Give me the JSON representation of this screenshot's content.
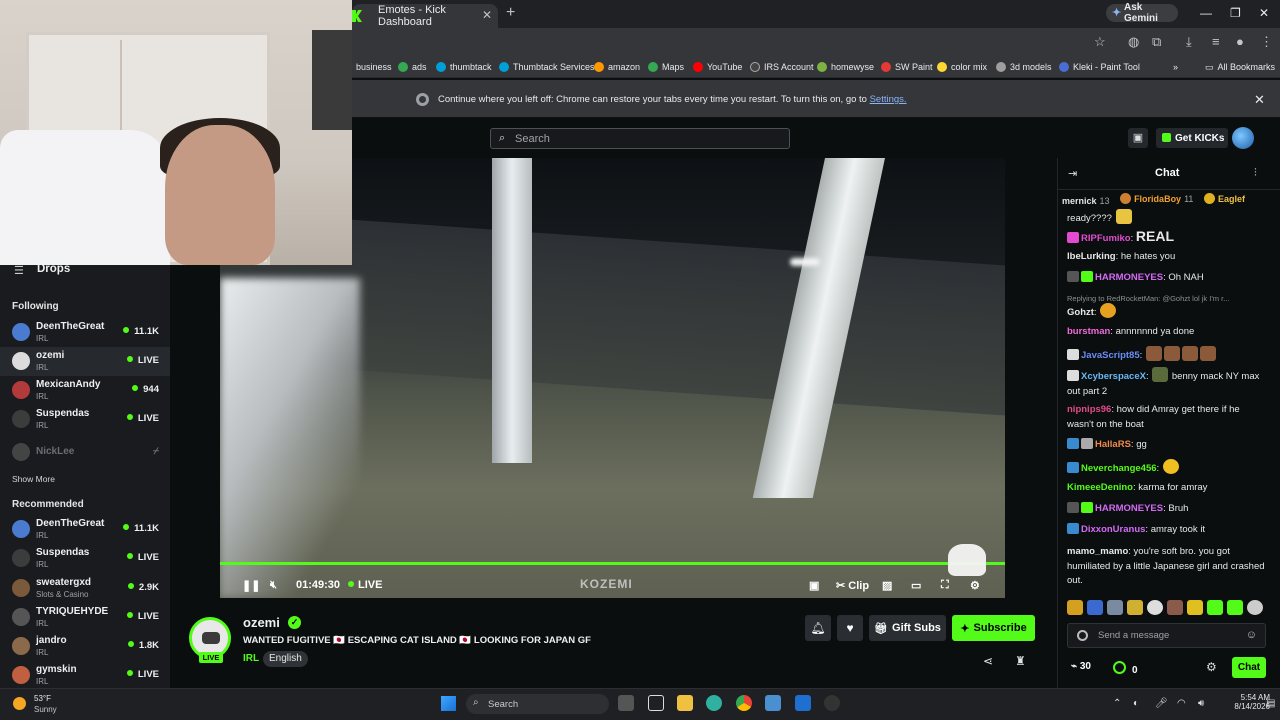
{
  "browser": {
    "tab_title": "Emotes - Kick Dashboard",
    "gemini_label": "Ask Gemini",
    "bookmarks": [
      "business",
      "ads",
      "thumbtack",
      "Thumbtack Services",
      "amazon",
      "Maps",
      "YouTube",
      "IRS Account",
      "homewyse",
      "SW Paint",
      "color mix",
      "3d models",
      "Kleki - Paint Tool"
    ],
    "all_bookmarks": "All Bookmarks",
    "restore_text": "Continue where you left off: Chrome can restore your tabs every time you restart. To turn this on, go to",
    "restore_link": "Settings."
  },
  "kick": {
    "search_placeholder": "Search",
    "get_kicks": "Get KICKs"
  },
  "sidebar": {
    "drops": "Drops",
    "following_header": "Following",
    "following": [
      {
        "name": "DeenTheGreat",
        "category": "IRL",
        "viewers": "11.1K",
        "color": "#4a7bd0"
      },
      {
        "name": "ozemi",
        "category": "IRL",
        "viewers": "LIVE",
        "color": "#dcdcdc"
      },
      {
        "name": "MexicanAndy",
        "category": "IRL",
        "viewers": "944",
        "color": "#b33a3a"
      },
      {
        "name": "Suspendas",
        "category": "IRL",
        "viewers": "LIVE",
        "color": "#3c3c3c"
      }
    ],
    "offline_name": "NickLee",
    "show_more": "Show More",
    "recommended_header": "Recommended",
    "recommended": [
      {
        "name": "DeenTheGreat",
        "category": "IRL",
        "viewers": "11.1K",
        "color": "#4a7bd0"
      },
      {
        "name": "Suspendas",
        "category": "IRL",
        "viewers": "LIVE",
        "color": "#3c3c3c"
      },
      {
        "name": "sweatergxd",
        "category": "Slots & Casino",
        "viewers": "2.9K",
        "color": "#7a5a3a"
      },
      {
        "name": "TYRIQUEHYDE",
        "category": "IRL",
        "viewers": "LIVE",
        "color": "#555"
      },
      {
        "name": "jandro",
        "category": "IRL",
        "viewers": "1.8K",
        "color": "#8a6a4a"
      },
      {
        "name": "gymskin",
        "category": "IRL",
        "viewers": "LIVE",
        "color": "#c06040"
      }
    ]
  },
  "player": {
    "time": "01:49:30",
    "live": "LIVE",
    "watermark": "KOZEMI",
    "clip": "Clip"
  },
  "stream": {
    "channel": "ozemi",
    "live_badge": "LIVE",
    "title": "WANTED FUGITIVE 🇯🇵 ESCAPING CAT ISLAND 🇯🇵 LOOKING FOR JAPAN GF",
    "category": "IRL",
    "language": "English",
    "gift_subs": "Gift Subs",
    "subscribe": "Subscribe"
  },
  "chat": {
    "title": "Chat",
    "gifters": [
      {
        "name": "mernick",
        "count": "13",
        "color": "#c0c0c0"
      },
      {
        "name": "FloridaBoy",
        "count": "11",
        "color": "#cd7f32"
      },
      {
        "name": "Eaglef",
        "count": "",
        "color": "#e0b020"
      }
    ],
    "messages": [
      {
        "user": "",
        "text": "ready????",
        "ucolor": "#e8e8e8"
      },
      {
        "user": "RIPFumiko",
        "text": "REAL",
        "ucolor": "#e24bd0"
      },
      {
        "user": "lbeLurking",
        "text": "he hates you",
        "ucolor": "#e8e8e8"
      },
      {
        "user": "HARMONEYES",
        "text": "Oh NAH",
        "ucolor": "#d36af5"
      },
      {
        "user": "Replying to RedRocketMan: @Gohzt lol jk I'm r...",
        "text": "",
        "ucolor": "#8b8f95"
      },
      {
        "user": "Gohzt",
        "text": "",
        "ucolor": "#e8e8e8"
      },
      {
        "user": "burstman",
        "text": "annnnnnd ya done",
        "ucolor": "#f06ad8"
      },
      {
        "user": "JavaScript85",
        "text": "",
        "ucolor": "#6a8cf5"
      },
      {
        "user": "XcyberspaceX",
        "text": "benny mack NY max out part 2",
        "ucolor": "#6ab8f5"
      },
      {
        "user": "nipnips96",
        "text": "how did Amray get there if he wasn't on the boat",
        "ucolor": "#e24b8a"
      },
      {
        "user": "HallaRS",
        "text": "gg",
        "ucolor": "#f08a4b"
      },
      {
        "user": "Neverchange456",
        "text": "",
        "ucolor": "#53fc18"
      },
      {
        "user": "KimeeeDenino",
        "text": "karma for amray",
        "ucolor": "#53fc18"
      },
      {
        "user": "HARMONEYES",
        "text": "Bruh",
        "ucolor": "#d36af5"
      },
      {
        "user": "DixxonUranus",
        "text": "amray took it",
        "ucolor": "#d36af5"
      },
      {
        "user": "mamo_mamo",
        "text": "you're soft bro. you got humiliated by a little Japanese girl and crashed out.",
        "ucolor": "#e8e8e8"
      }
    ],
    "send_placeholder": "Send a message",
    "points": "30",
    "kicks_balance": "0",
    "chat_button": "Chat"
  },
  "taskbar": {
    "temp": "53°F",
    "condition": "Sunny",
    "search": "Search",
    "time": "5:54 AM",
    "date": "8/14/2026"
  },
  "colors": {
    "accent": "#53fc18",
    "bg": "#0b0e0f",
    "panel": "#191b1f"
  }
}
